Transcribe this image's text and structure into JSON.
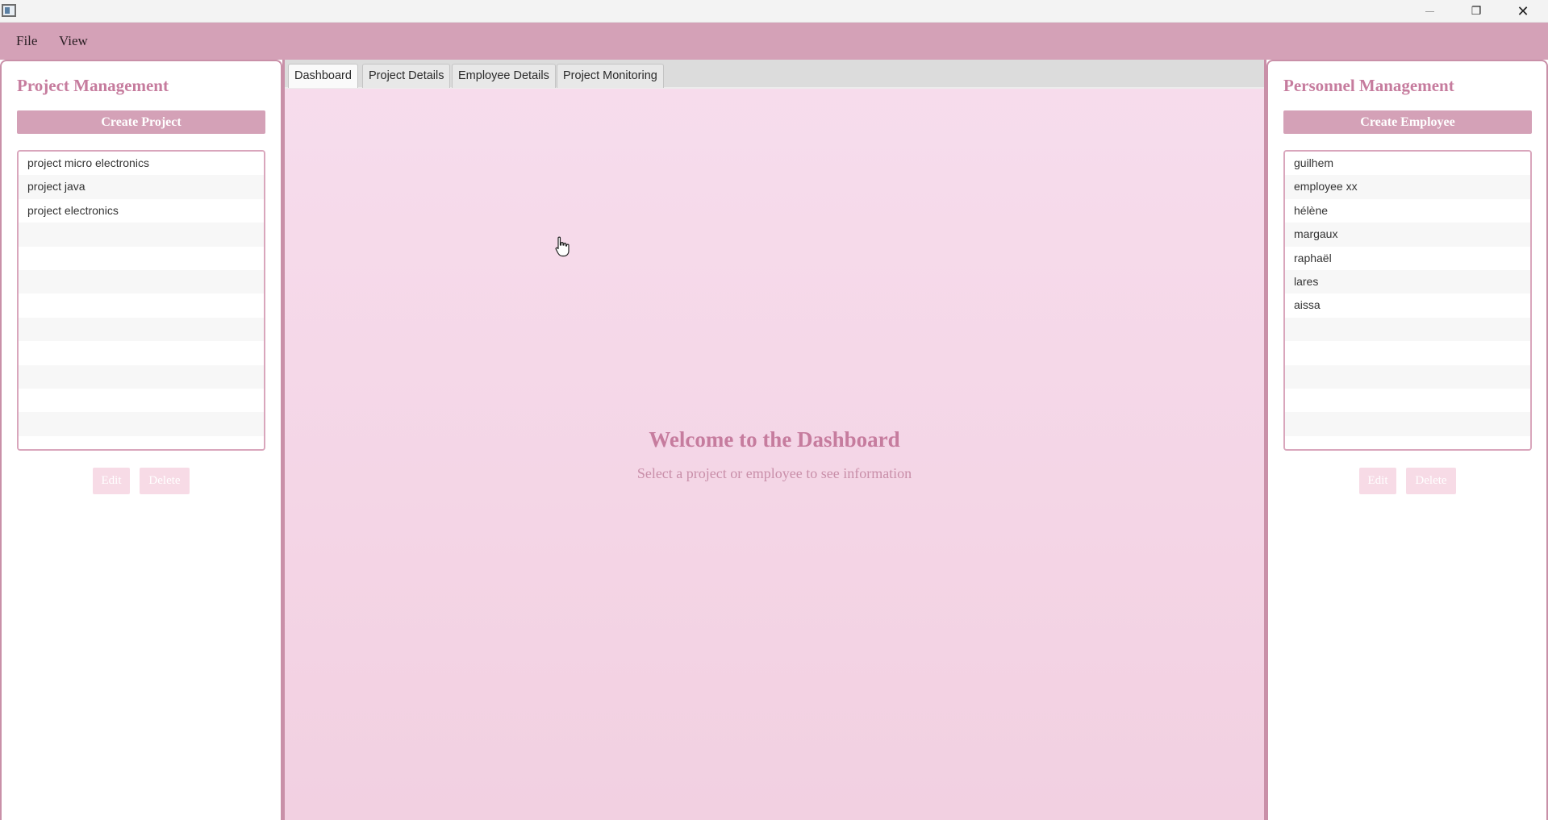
{
  "window": {
    "min_icon": "minimize-icon",
    "restore_icon": "restore-icon",
    "restore_glyph": "❐",
    "close_icon": "close-icon",
    "close_glyph": "✕"
  },
  "menubar": {
    "items": [
      "File",
      "View"
    ]
  },
  "left_panel": {
    "title": "Project Management",
    "create_label": "Create Project",
    "items": [
      "project micro electronics",
      "project java",
      "project electronics",
      "",
      "",
      "",
      "",
      "",
      "",
      "",
      "",
      "",
      ""
    ],
    "edit_label": "Edit",
    "delete_label": "Delete"
  },
  "right_panel": {
    "title": "Personnel Management",
    "create_label": "Create Employee",
    "items": [
      "guilhem",
      "employee xx",
      "hélène",
      "margaux",
      "raphaël",
      "lares",
      "aissa",
      "",
      "",
      "",
      "",
      "",
      ""
    ],
    "edit_label": "Edit",
    "delete_label": "Delete"
  },
  "tabs": [
    {
      "label": "Dashboard",
      "active": true
    },
    {
      "label": "Project Details",
      "active": false
    },
    {
      "label": "Employee Details",
      "active": false
    },
    {
      "label": "Project Monitoring",
      "active": false
    }
  ],
  "dashboard": {
    "title": "Welcome to the Dashboard",
    "subtitle": "Select a project or employee to see information"
  },
  "colors": {
    "accent": "#d4a1b7",
    "title_pink": "#c67c9e",
    "border_pink": "#c990a8"
  }
}
